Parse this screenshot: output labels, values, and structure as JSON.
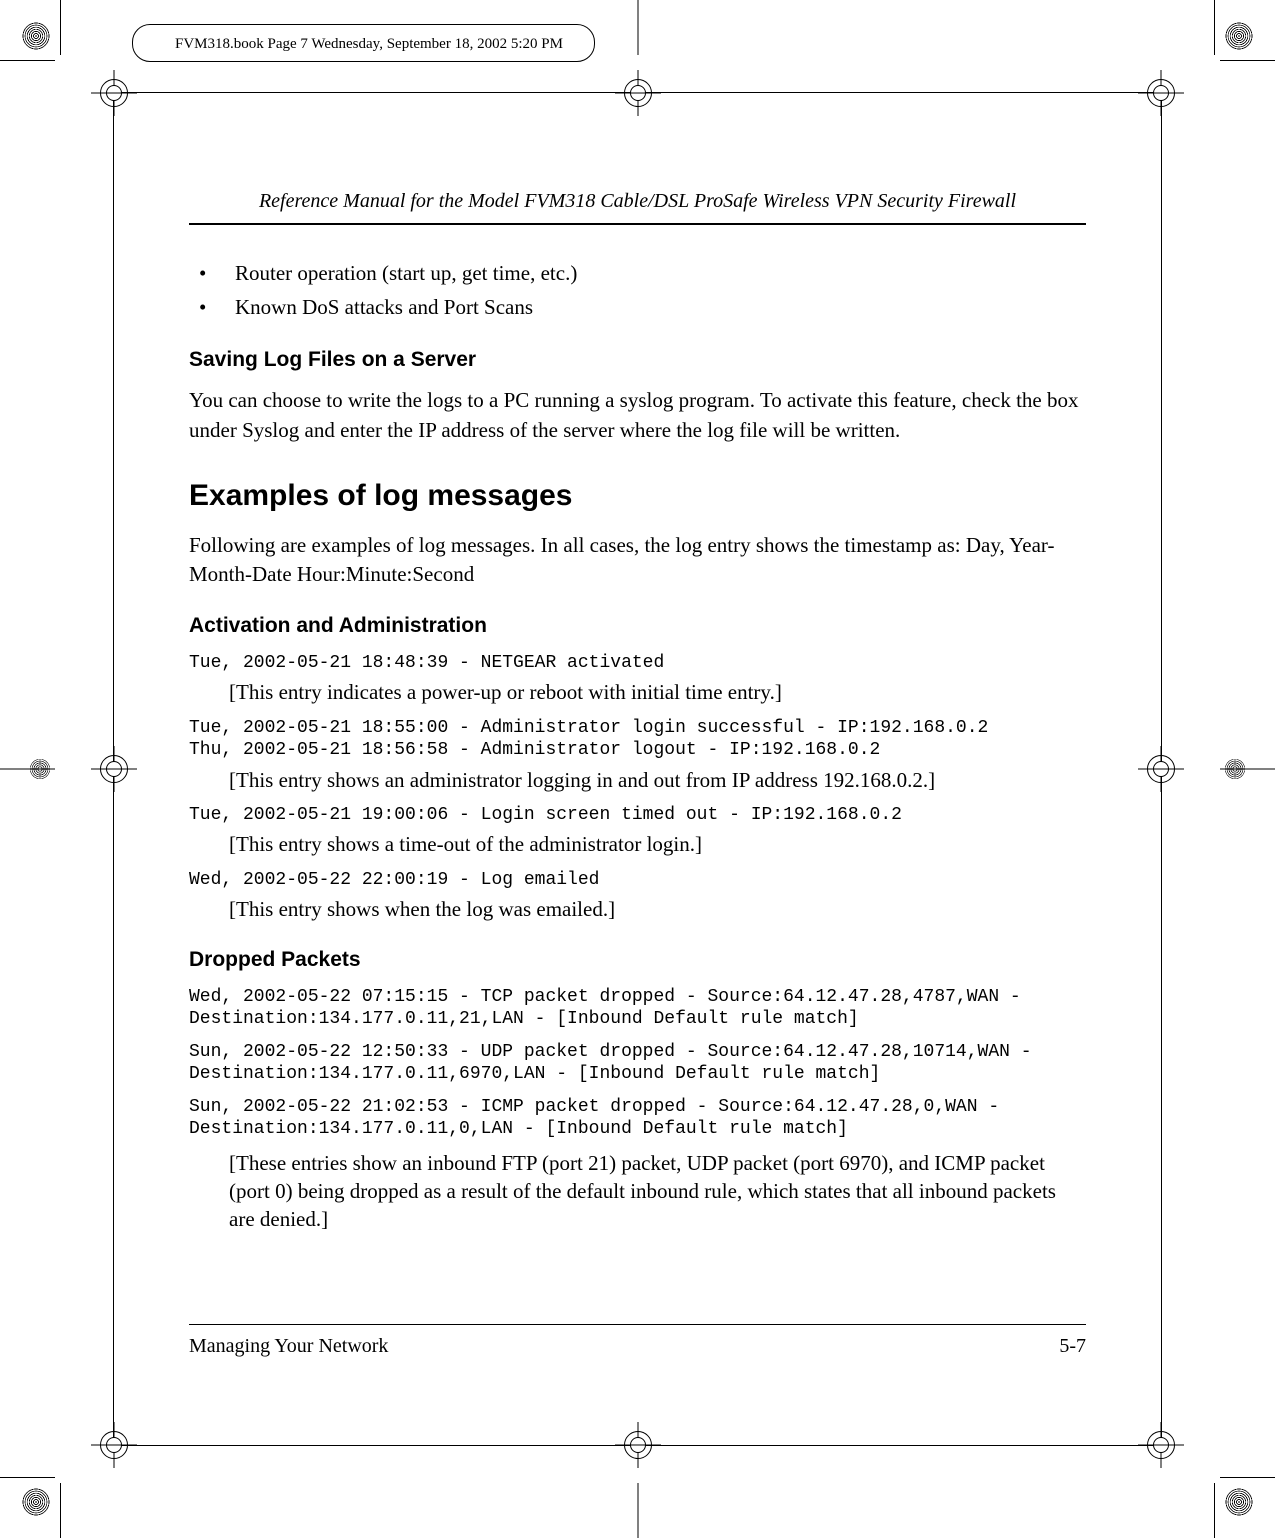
{
  "slug": "FVM318.book  Page 7  Wednesday, September 18, 2002  5:20 PM",
  "running_head": "Reference Manual for the Model FVM318 Cable/DSL ProSafe Wireless VPN Security Firewall",
  "bullets": [
    "Router operation (start up, get time, etc.)",
    "Known DoS attacks and Port Scans"
  ],
  "saving": {
    "heading": "Saving Log Files on a Server",
    "body": "You can choose to write the logs to a PC running a syslog program. To activate this feature, check the box under Syslog and enter the IP address of the server where the log file will be written."
  },
  "examples_heading": "Examples of log messages",
  "examples_intro": "Following are examples of log messages. In all cases, the log entry shows the timestamp as:    Day, Year-Month-Date  Hour:Minute:Second",
  "activation": {
    "heading": "Activation and Administration",
    "log1": "Tue, 2002-05-21 18:48:39 - NETGEAR activated",
    "expl1": "[This entry indicates a power-up or reboot with initial time entry.]",
    "log2": "Tue, 2002-05-21 18:55:00 - Administrator login successful - IP:192.168.0.2\nThu, 2002-05-21 18:56:58 - Administrator logout - IP:192.168.0.2",
    "expl2": "[This entry shows an administrator logging in and out from IP address 192.168.0.2.]",
    "log3": "Tue, 2002-05-21 19:00:06 - Login screen timed out - IP:192.168.0.2",
    "expl3": "[This entry shows a time-out of the administrator login.]",
    "log4": "Wed, 2002-05-22 22:00:19 - Log emailed",
    "expl4": "[This entry shows when the log was emailed.]"
  },
  "dropped": {
    "heading": "Dropped Packets",
    "log1": "Wed, 2002-05-22 07:15:15 - TCP packet dropped - Source:64.12.47.28,4787,WAN - Destination:134.177.0.11,21,LAN - [Inbound Default rule match]",
    "log2": "Sun, 2002-05-22 12:50:33 - UDP packet dropped - Source:64.12.47.28,10714,WAN - Destination:134.177.0.11,6970,LAN - [Inbound Default rule match]",
    "log3": "Sun, 2002-05-22 21:02:53 - ICMP packet dropped - Source:64.12.47.28,0,WAN - Destination:134.177.0.11,0,LAN - [Inbound Default rule match]",
    "expl": "[These entries show an inbound FTP (port 21) packet, UDP packet (port 6970), and ICMP packet (port 0) being dropped as a result of the default inbound rule, which states that all inbound packets are denied.]"
  },
  "footer": {
    "left": "Managing Your Network",
    "right": "5-7"
  }
}
